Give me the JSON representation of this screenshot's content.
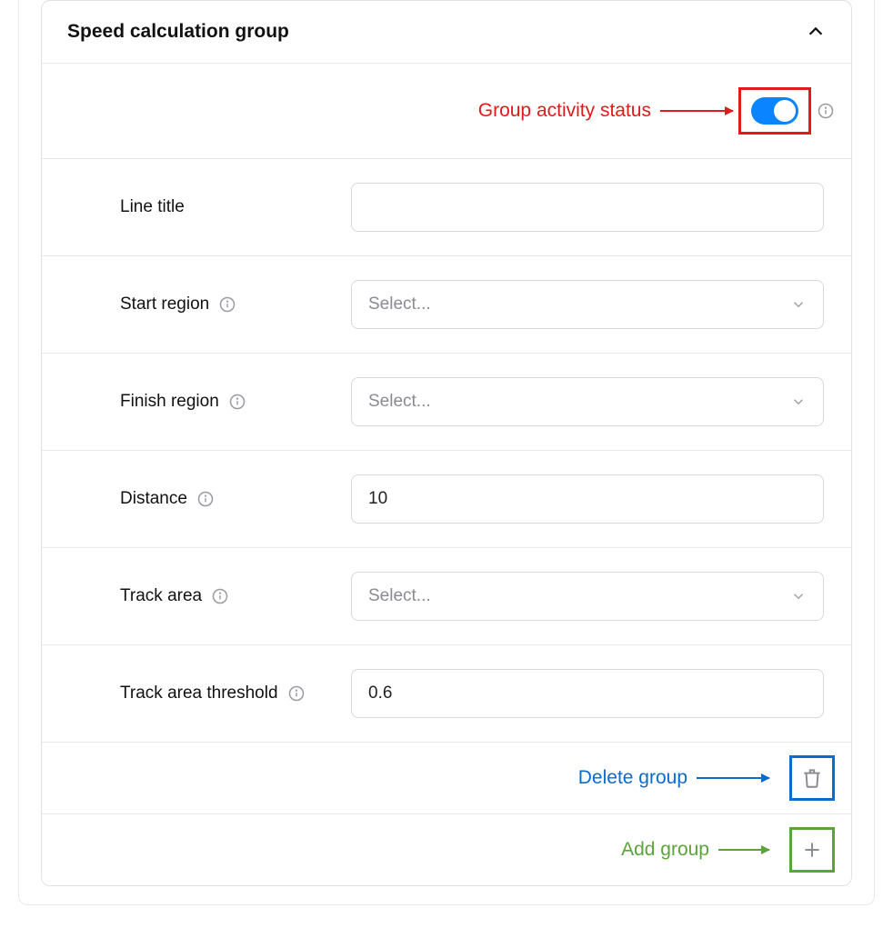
{
  "panel": {
    "title": "Speed calculation group"
  },
  "annotations": {
    "activity": "Group activity status",
    "delete": "Delete group",
    "add": "Add group"
  },
  "fields": {
    "line_title": {
      "label": "Line title",
      "value": ""
    },
    "start_region": {
      "label": "Start region",
      "placeholder": "Select..."
    },
    "finish_region": {
      "label": "Finish region",
      "placeholder": "Select..."
    },
    "distance": {
      "label": "Distance",
      "value": "10"
    },
    "track_area": {
      "label": "Track area",
      "placeholder": "Select..."
    },
    "track_area_threshold": {
      "label": "Track area threshold",
      "value": "0.6"
    }
  },
  "toggle_on": true
}
